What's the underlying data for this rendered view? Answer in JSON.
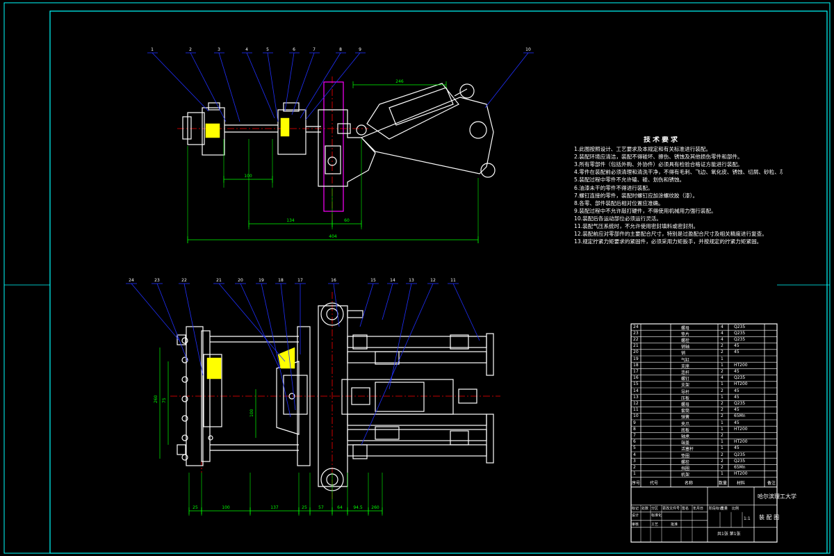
{
  "drawing": {
    "frame_color": "#00ffff",
    "part_color": "#ffffff",
    "center_line_color": "#ff0000",
    "hatch_color": "#ffff00",
    "leader_color": "#2030ff",
    "dimension_color": "#00ff00",
    "rod_color": "#ff00ff"
  },
  "technical_notes": {
    "title": "技术要求",
    "items": [
      "1.此图按照设计、工艺要求及本规定和有关标准进行装配。",
      "2.装配环境应清洁，装配不得碰坏、擦伤、锈蚀及其他损伤零件和部件。",
      "3.所有零部件（包括外购、外协件）必须具有检验合格证方能进行装配。",
      "4.零件在装配前必须清理和清洗干净，不得有毛刺、飞边、氧化皮、锈蚀、切屑、砂粒、灰尘和油污等。",
      "5.装配过程中零件不允许磕、碰、划伤和锈蚀。",
      "6.油漆未干的零件不得进行装配。",
      "7.螺钉连接的零件，装配时螺钉应加涂螺纹胶（漆）。",
      "8.各零、部件装配后相对位置应准确。",
      "9.装配过程中不允许敲打硬件，不得使用机械用力强行装配。",
      "10.装配后各运动部位必须运行灵活。",
      "11.装配气压系统时，不允许使用密封填料或密封剂。",
      "12.装配前应对零部件的主要配合尺寸，特别是过盈配合尺寸及相关精度进行复查。",
      "13.规定拧紧力矩要求的紧固件，必须采用力矩扳手，并按规定的拧紧力矩紧固。"
    ]
  },
  "title_block": {
    "school": "哈尔滨理工大学",
    "drawing_name": "装 配 图",
    "sheet_info": "共1张 第1张",
    "scale": "1:1",
    "labels": [
      "标记",
      "处数",
      "分区",
      "更改文件号",
      "签名",
      "年月日"
    ],
    "labels2": [
      "设计",
      "标准化",
      "阶段标记",
      "重量",
      "比例"
    ],
    "labels3": [
      "审核",
      "工艺",
      "批准"
    ]
  },
  "bom": {
    "headers": [
      "序号",
      "代号",
      "名称",
      "数量",
      "材料",
      "备注"
    ],
    "rows": [
      {
        "no": "24",
        "name": "螺母",
        "qty": "4",
        "mat": "Q235"
      },
      {
        "no": "23",
        "name": "垫片",
        "qty": "4",
        "mat": "Q235"
      },
      {
        "no": "22",
        "name": "螺栓",
        "qty": "4",
        "mat": "Q235"
      },
      {
        "no": "21",
        "name": "销轴",
        "qty": "2",
        "mat": "45"
      },
      {
        "no": "20",
        "name": "销",
        "qty": "2",
        "mat": "45"
      },
      {
        "no": "19",
        "name": "气缸",
        "qty": "1",
        "mat": ""
      },
      {
        "no": "18",
        "name": "支座",
        "qty": "1",
        "mat": "HT200"
      },
      {
        "no": "17",
        "name": "连杆",
        "qty": "2",
        "mat": "45"
      },
      {
        "no": "16",
        "name": "螺钉",
        "qty": "4",
        "mat": "Q235"
      },
      {
        "no": "15",
        "name": "支架",
        "qty": "1",
        "mat": "HT200"
      },
      {
        "no": "14",
        "name": "导杆",
        "qty": "2",
        "mat": "45"
      },
      {
        "no": "13",
        "name": "压板",
        "qty": "1",
        "mat": "45"
      },
      {
        "no": "12",
        "name": "螺母",
        "qty": "2",
        "mat": "Q235"
      },
      {
        "no": "11",
        "name": "套筒",
        "qty": "2",
        "mat": "45"
      },
      {
        "no": "10",
        "name": "弹簧",
        "qty": "2",
        "mat": "65Mn"
      },
      {
        "no": "9",
        "name": "夹爪",
        "qty": "1",
        "mat": "45"
      },
      {
        "no": "8",
        "name": "底板",
        "qty": "1",
        "mat": "HT200"
      },
      {
        "no": "7",
        "name": "轴承",
        "qty": "2",
        "mat": ""
      },
      {
        "no": "6",
        "name": "端盖",
        "qty": "1",
        "mat": "HT200"
      },
      {
        "no": "5",
        "name": "活塞杆",
        "qty": "1",
        "mat": "45"
      },
      {
        "no": "4",
        "name": "垫圈",
        "qty": "2",
        "mat": "Q235"
      },
      {
        "no": "3",
        "name": "螺栓",
        "qty": "2",
        "mat": "Q235"
      },
      {
        "no": "2",
        "name": "挡圈",
        "qty": "2",
        "mat": "65Mn"
      },
      {
        "no": "1",
        "name": "机架",
        "qty": "1",
        "mat": "HT200"
      }
    ]
  },
  "top_view": {
    "balloons": [
      "1",
      "2",
      "3",
      "4",
      "5",
      "6",
      "7",
      "8",
      "9",
      "10"
    ],
    "dims": [
      "100",
      "134",
      "60",
      "404",
      "246"
    ]
  },
  "bottom_view": {
    "balloons": [
      "24",
      "23",
      "22",
      "21",
      "20",
      "19",
      "18",
      "17",
      "16",
      "15",
      "14",
      "13",
      "12",
      "11"
    ],
    "dims": [
      "25",
      "100",
      "137",
      "25",
      "57",
      "64",
      "94.5",
      "260",
      "100",
      "75"
    ]
  }
}
